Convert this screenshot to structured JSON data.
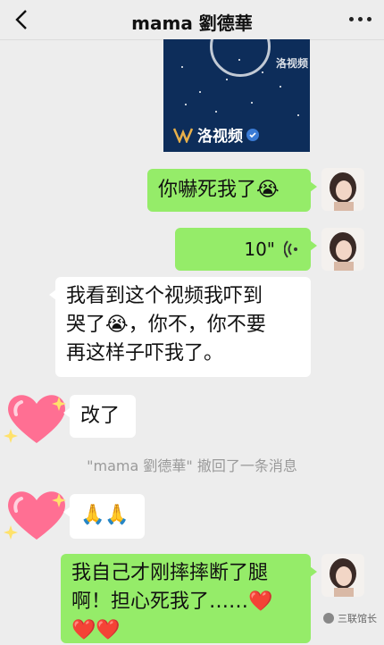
{
  "header": {
    "title": "mama 劉德華"
  },
  "video": {
    "watermark": "洛视频",
    "source_label": "洛视频"
  },
  "messages": {
    "m1": {
      "text": "你嚇死我了😭"
    },
    "m2": {
      "duration": "10\""
    },
    "m3": {
      "line1": "我看到这个视频我吓到",
      "line2": "哭了😭，你不，你不要",
      "line3": "再这样子吓我了。"
    },
    "m4": {
      "text": "改了"
    },
    "system": "\"mama 劉德華\" 撤回了一条消息",
    "m5": {
      "text": "🙏🙏"
    },
    "m6": {
      "line1": "我自己才刚摔摔断了腿",
      "line2": "啊！担心死我了……❤️",
      "line3": "❤️❤️"
    }
  },
  "watermark_corner": "三联馆长",
  "colors": {
    "green_bubble": "#95ec69",
    "background": "#ededed",
    "heart": "#ff5f86"
  }
}
